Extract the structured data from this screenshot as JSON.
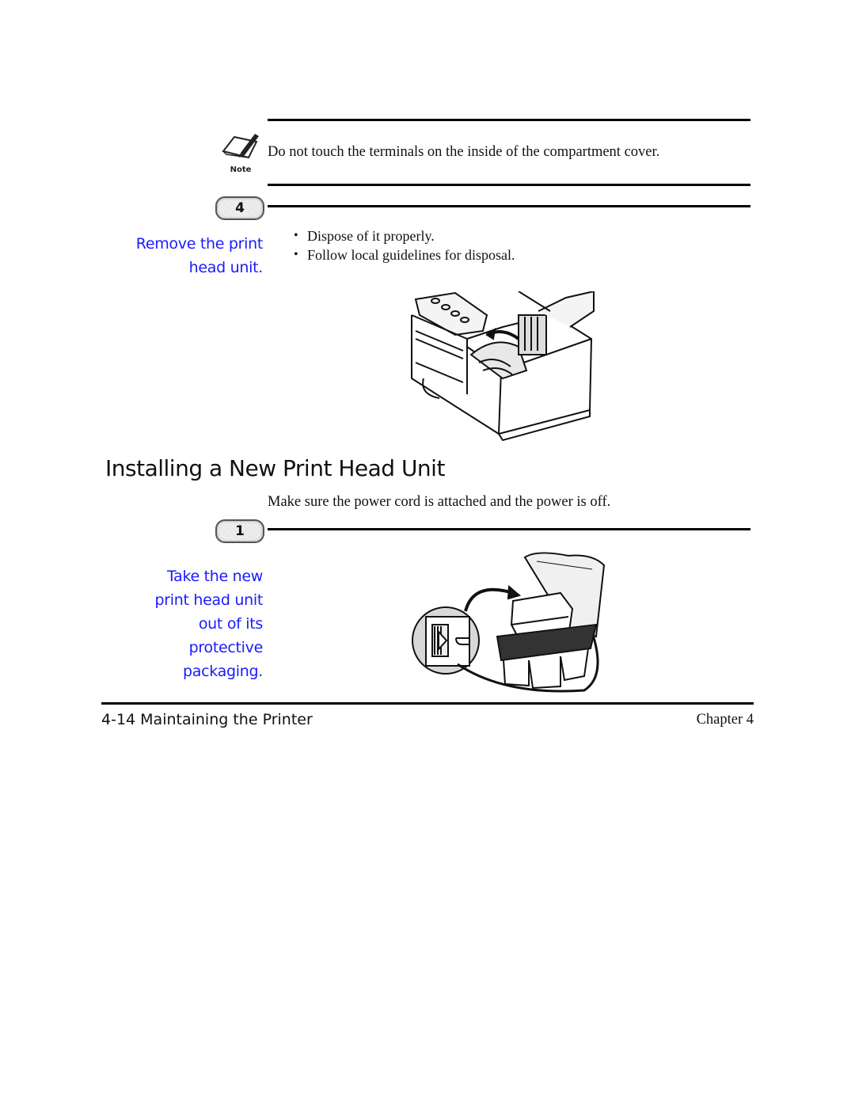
{
  "note": {
    "icon": "note-pencil-icon",
    "icon_label": "Note",
    "text": "Do not touch the terminals on the inside of the compartment cover."
  },
  "step4": {
    "number": "4",
    "instruction_line1": "Remove the print",
    "instruction_line2": "head unit.",
    "bullets": [
      "Dispose of it properly.",
      "Follow local guidelines for disposal."
    ],
    "illustration": "printer-open-print-head-removal"
  },
  "section": {
    "title": "Installing a New Print Head Unit",
    "intro": "Make sure the power cord is attached and the power is off."
  },
  "step1": {
    "number": "1",
    "instruction_lines": [
      "Take the new",
      "print head unit",
      "out of its",
      "protective",
      "packaging."
    ],
    "illustration": "print-head-unpacking"
  },
  "footer": {
    "page_label": "4-14 Maintaining the Printer",
    "chapter": "Chapter 4"
  },
  "colors": {
    "instruction_blue": "#1a1aff",
    "text": "#111111",
    "rule": "#000000"
  }
}
